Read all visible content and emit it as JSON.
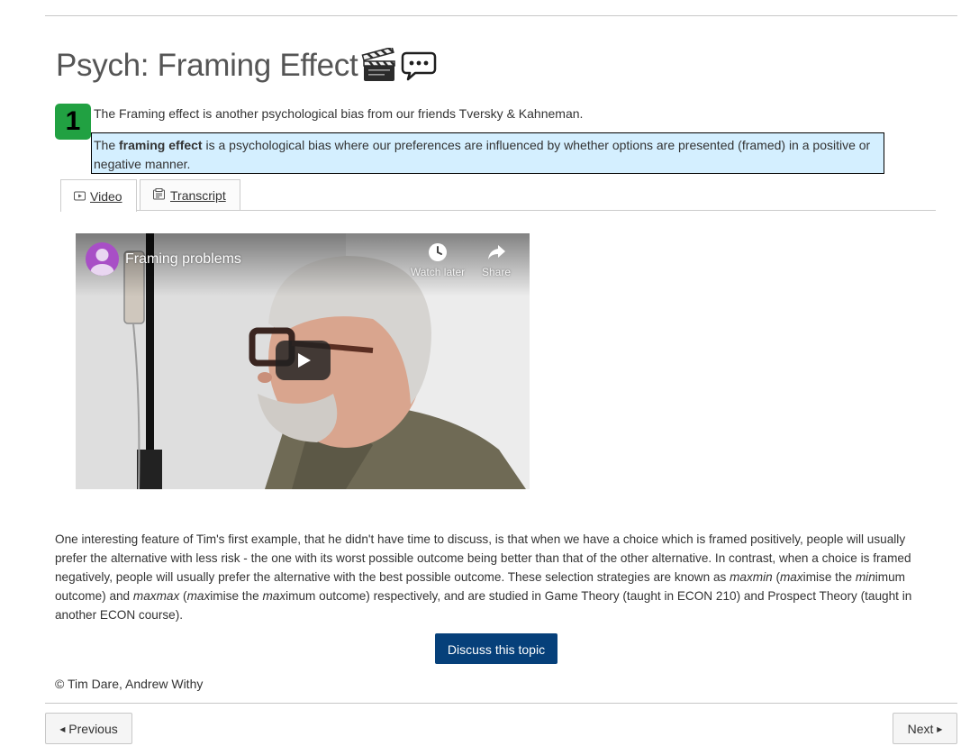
{
  "page": {
    "title": "Psych: Framing Effect",
    "title_icons": [
      "clapperboard-icon",
      "speech-balloon-icon"
    ]
  },
  "step": {
    "number": "1",
    "color": "#21a142"
  },
  "intro": "The Framing effect is another psychological bias from our friends Tversky & Kahneman.",
  "definition": {
    "prefix": "The ",
    "term": "framing effect",
    "rest": " is a psychological bias where our preferences are influenced by whether options are presented (framed) in a positive or negative manner.",
    "background": "#d4efff"
  },
  "tabs": [
    {
      "label": "Video",
      "icon": "video-icon",
      "active": true
    },
    {
      "label": "Transcript",
      "icon": "transcript-icon",
      "active": false
    }
  ],
  "video": {
    "title": "Framing problems",
    "watch_later": "Watch later",
    "share": "Share"
  },
  "body": {
    "p1": "One interesting feature of Tim's first example, that he didn't have time to discuss, is that when we have a choice which is framed positively, people will usually prefer the alternative with less risk - the one with its worst possible outcome being better than that of the other alternative. In contrast, when a choice is framed negatively, people will usually prefer the alternative with the best possible outcome. These selection strategies are known as ",
    "maxmin": "maxmin",
    "p2": " (",
    "max1": "max",
    "p3": "imise the ",
    "min1": "min",
    "p4": "imum outcome) and ",
    "maxmax": "maxmax",
    "p5": " (",
    "max2": "max",
    "p6": "imise the ",
    "max3": "max",
    "p7": "imum outcome) respectively, and are studied in Game Theory (taught in ECON 210) and Prospect Theory (taught in another ECON course)."
  },
  "discuss_label": "Discuss this topic",
  "copyright": "© Tim Dare, Andrew Withy",
  "nav": {
    "previous": "Previous",
    "next": "Next"
  },
  "colors": {
    "button": "#06407a",
    "text": "#333333"
  }
}
